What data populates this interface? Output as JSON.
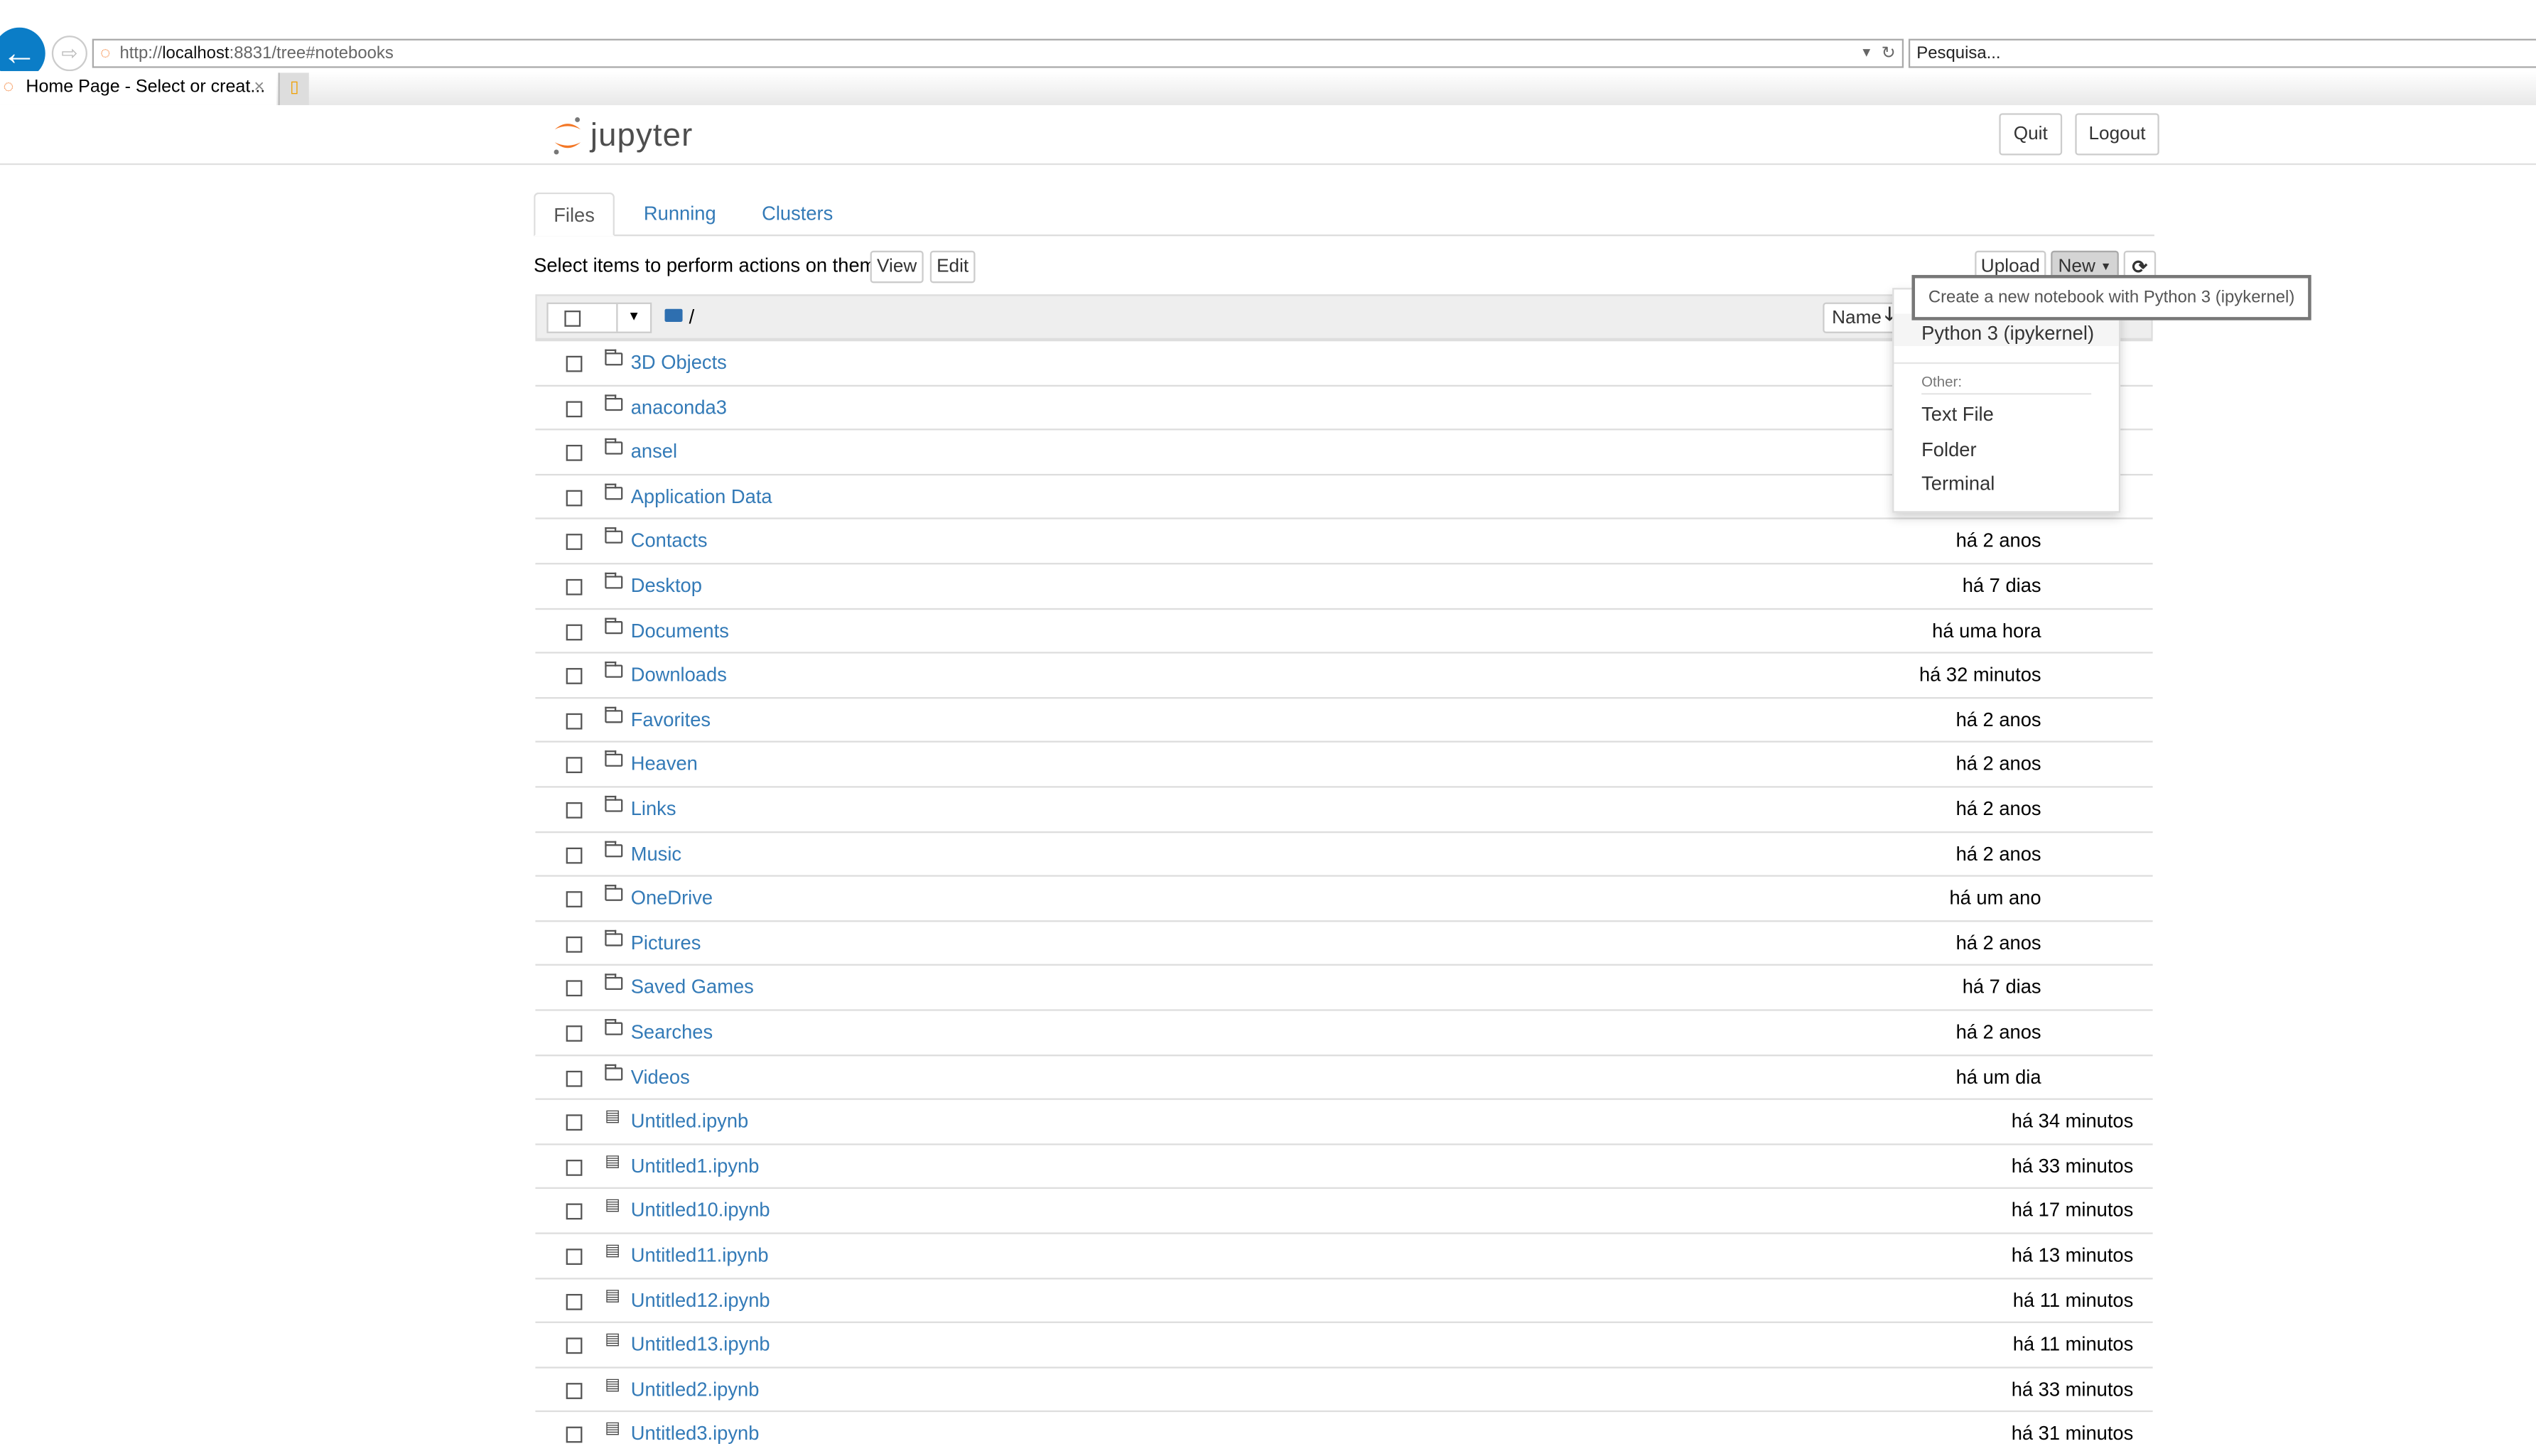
{
  "browser": {
    "url_prefix": "http://",
    "url_host": "localhost",
    "url_rest": ":8831/tree#notebooks",
    "search_placeholder": "Pesquisa...",
    "tab_title": "Home Page - Select or creat...",
    "tab_close": "×"
  },
  "header": {
    "logo": "jupyter",
    "quit": "Quit",
    "logout": "Logout"
  },
  "tabs": [
    {
      "label": "Files",
      "active": true
    },
    {
      "label": "Running"
    },
    {
      "label": "Clusters"
    }
  ],
  "toolbar": {
    "hint": "Select items to perform actions on them.",
    "view": "View",
    "edit": "Edit",
    "upload": "Upload",
    "new": "New"
  },
  "breadcrumb": "/",
  "sort": {
    "name": "Name"
  },
  "tooltip": "Create a new notebook with Python 3 (ipykernel)",
  "new_menu": {
    "kernel": "Python 3 (ipykernel)",
    "other_header": "Other:",
    "items": [
      "Text File",
      "Folder",
      "Terminal"
    ]
  },
  "files": [
    {
      "name": "3D Objects",
      "type": "folder",
      "modified": ""
    },
    {
      "name": "anaconda3",
      "type": "folder",
      "modified": ""
    },
    {
      "name": "ansel",
      "type": "folder",
      "modified": ""
    },
    {
      "name": "Application Data",
      "type": "folder",
      "modified": ""
    },
    {
      "name": "Contacts",
      "type": "folder",
      "modified": "há 2 anos"
    },
    {
      "name": "Desktop",
      "type": "folder",
      "modified": "há 7 dias"
    },
    {
      "name": "Documents",
      "type": "folder",
      "modified": "há uma hora"
    },
    {
      "name": "Downloads",
      "type": "folder",
      "modified": "há 32 minutos"
    },
    {
      "name": "Favorites",
      "type": "folder",
      "modified": "há 2 anos"
    },
    {
      "name": "Heaven",
      "type": "folder",
      "modified": "há 2 anos"
    },
    {
      "name": "Links",
      "type": "folder",
      "modified": "há 2 anos"
    },
    {
      "name": "Music",
      "type": "folder",
      "modified": "há 2 anos"
    },
    {
      "name": "OneDrive",
      "type": "folder",
      "modified": "há um ano"
    },
    {
      "name": "Pictures",
      "type": "folder",
      "modified": "há 2 anos"
    },
    {
      "name": "Saved Games",
      "type": "folder",
      "modified": "há 7 dias"
    },
    {
      "name": "Searches",
      "type": "folder",
      "modified": "há 2 anos"
    },
    {
      "name": "Videos",
      "type": "folder",
      "modified": "há um dia"
    },
    {
      "name": "Untitled.ipynb",
      "type": "notebook",
      "modified": "há 34 minutos"
    },
    {
      "name": "Untitled1.ipynb",
      "type": "notebook",
      "modified": "há 33 minutos"
    },
    {
      "name": "Untitled10.ipynb",
      "type": "notebook",
      "modified": "há 17 minutos"
    },
    {
      "name": "Untitled11.ipynb",
      "type": "notebook",
      "modified": "há 13 minutos"
    },
    {
      "name": "Untitled12.ipynb",
      "type": "notebook",
      "modified": "há 11 minutos"
    },
    {
      "name": "Untitled13.ipynb",
      "type": "notebook",
      "modified": "há 11 minutos"
    },
    {
      "name": "Untitled2.ipynb",
      "type": "notebook",
      "modified": "há 33 minutos"
    },
    {
      "name": "Untitled3.ipynb",
      "type": "notebook",
      "modified": "há 31 minutos"
    }
  ],
  "colors": {
    "link": "#337ab7",
    "orange": "#f37726",
    "ie_blue": "#0b7dc7"
  }
}
